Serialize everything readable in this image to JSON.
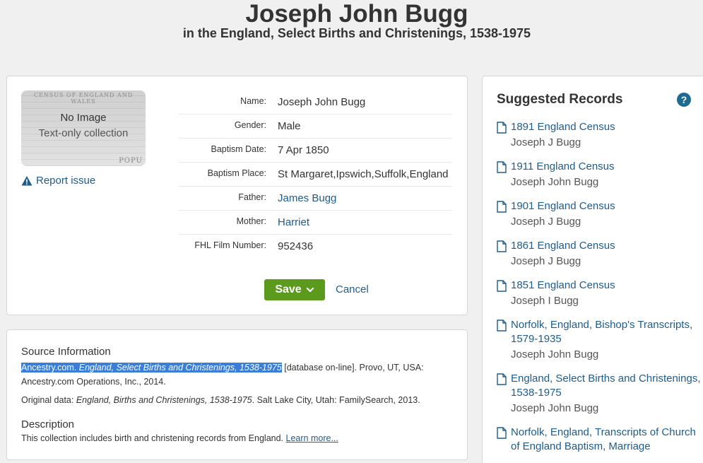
{
  "header": {
    "title": "Joseph John Bugg",
    "subtitle": "in the England, Select Births and Christenings, 1538-1975"
  },
  "thumbnail": {
    "census_header": "CENSUS OF ENGLAND AND WALES",
    "popu": "POPU",
    "no_image": "No Image",
    "text_only": "Text-only collection"
  },
  "report_issue": "Report issue",
  "fields": [
    {
      "label": "Name:",
      "value": "Joseph John Bugg"
    },
    {
      "label": "Gender:",
      "value": "Male"
    },
    {
      "label": "Baptism Date:",
      "value": "7 Apr 1850"
    },
    {
      "label": "Baptism Place:",
      "value": "St Margaret,Ipswich,Suffolk,England"
    },
    {
      "label": "Father:",
      "value": "James Bugg"
    },
    {
      "label": "Mother:",
      "value": "Harriet"
    },
    {
      "label": "FHL Film Number:",
      "value": "952436"
    }
  ],
  "actions": {
    "save": "Save",
    "cancel": "Cancel"
  },
  "source": {
    "title": "Source Information",
    "highlight_org": "Ancestry.com.",
    "highlight_db": "England, Select Births and Christenings, 1538-1975",
    "citation_rest": "[database on-line]. Provo, UT, USA: Ancestry.com Operations, Inc., 2014.",
    "original_prefix": "Original data:",
    "original_title": "England, Births and Christenings, 1538-1975",
    "original_rest": ". Salt Lake City, Utah: FamilySearch, 2013."
  },
  "description": {
    "title": "Description",
    "text": "This collection includes birth and christening records from England.",
    "learn_more": "Learn more..."
  },
  "suggested": {
    "title": "Suggested Records",
    "items": [
      {
        "record": "1891 England Census",
        "person": "Joseph J Bugg"
      },
      {
        "record": "1911 England Census",
        "person": "Joseph John Bugg"
      },
      {
        "record": "1901 England Census",
        "person": "Joseph J Bugg"
      },
      {
        "record": "1861 England Census",
        "person": "Joseph J Bugg"
      },
      {
        "record": "1851 England Census",
        "person": "Joseph I Bugg"
      },
      {
        "record": "Norfolk, England, Bishop's Transcripts, 1579-1935",
        "person": "Joseph John Bugg"
      },
      {
        "record": "England, Select Births and Christenings, 1538-1975",
        "person": "Joseph John Bugg"
      },
      {
        "record": "Norfolk, England, Transcripts of Church of England Baptism, Marriage",
        "person": ""
      }
    ]
  },
  "colors": {
    "link": "#1e5c8c",
    "save_green": "#5b9a1c",
    "highlight": "#3a7ed8",
    "help": "#1d6b93"
  }
}
